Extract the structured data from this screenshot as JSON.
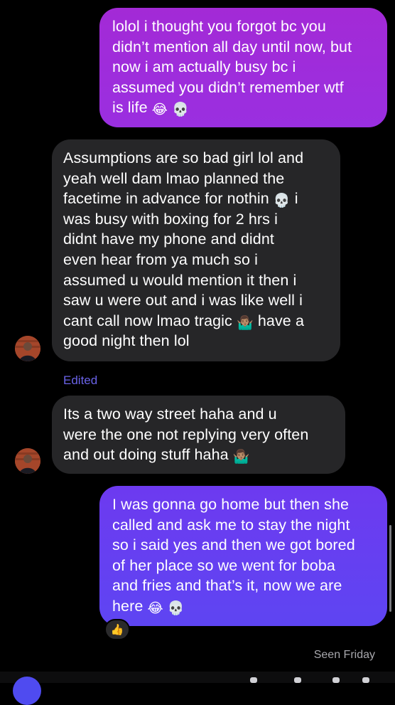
{
  "messages": [
    {
      "id": "sent-1",
      "direction": "outgoing",
      "lines": [
        "lolol i thought you forgot bc you",
        "didn’t mention all day until now, but",
        "now i am actually busy bc i",
        "assumed you didn’t remember wtf",
        "is life"
      ],
      "emojis": [
        "😂",
        "💀"
      ]
    },
    {
      "id": "recv-1",
      "direction": "incoming",
      "lines": [
        "Assumptions are so bad girl lol and",
        "yeah well dam lmao planned the",
        "facetime in advance for nothin",
        "was busy with boxing for 2 hrs i",
        "didnt have my phone and didnt",
        "even hear from ya much so i",
        "assumed u would mention it then i",
        "saw u were out and i was like well i",
        "cant call now lmao tragic",
        "good night then lol"
      ],
      "line3_tail": "i",
      "line9_tail": "have a",
      "emojis": [
        "💀",
        "🤷🏽‍♂️"
      ]
    },
    {
      "id": "recv-2",
      "direction": "incoming",
      "lines": [
        "Its a two way street haha and u",
        "were the one not replying very often",
        "and out doing stuff haha"
      ],
      "emojis": [
        "🤷🏽‍♂️"
      ]
    },
    {
      "id": "sent-2",
      "direction": "outgoing",
      "lines": [
        "I was gonna go home but then she",
        "called and ask me to stay the night",
        "so i said yes and then we got bored",
        "of her place so we went for boba",
        "and fries and that’s it, now we are",
        "here"
      ],
      "emojis": [
        "😂",
        "💀"
      ]
    }
  ],
  "edited_label": "Edited",
  "reaction": {
    "emoji": "👍",
    "icon": "thumbs-up-icon"
  },
  "seen_label": "Seen Friday",
  "colors": {
    "sent_1": "#a32ad6",
    "sent_2": "#6d3af0",
    "received": "#262628",
    "background": "#000000",
    "edited": "#6a63e8",
    "seen": "#a8a8ad"
  }
}
